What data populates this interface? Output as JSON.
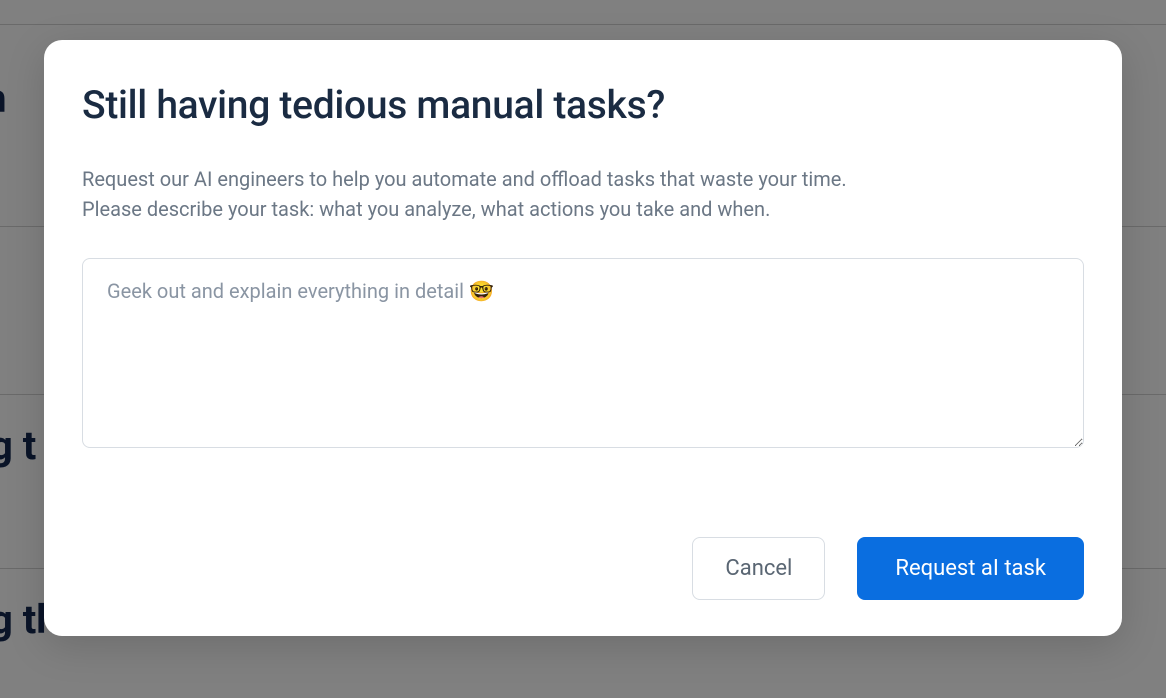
{
  "backdrop": {
    "line1": "ith",
    "line2": "g t",
    "line3": "g this creative"
  },
  "modal": {
    "title": "Still having tedious manual tasks?",
    "description_line1": "Request our AI engineers to help you automate and offload tasks that waste your time.",
    "description_line2": "Please describe your task: what you analyze, what actions you take and when.",
    "textarea_placeholder": "Geek out and explain everything in detail 🤓",
    "textarea_value": "",
    "cancel_label": "Cancel",
    "submit_label": "Request aI task"
  }
}
